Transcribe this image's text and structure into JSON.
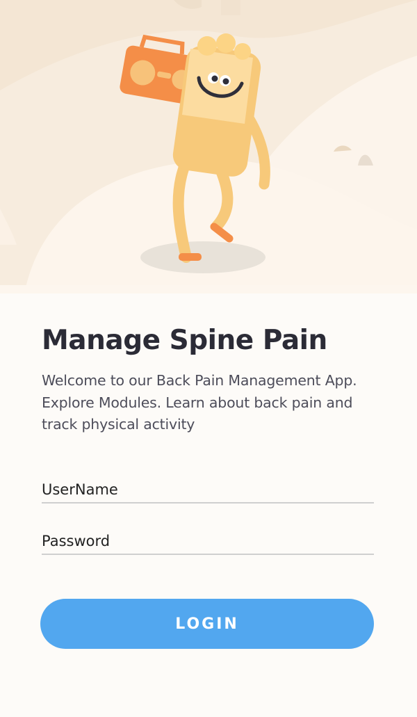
{
  "hero": {
    "illustration": "dancing-spine-with-boombox",
    "colors": {
      "background": "#f4e6d4",
      "hill_light": "#fbf3ea",
      "character": "#f7c97a",
      "character_head": "#fcdca0",
      "boombox": "#f48e48",
      "shadow": "#e8e2d9"
    }
  },
  "main": {
    "title": "Manage Spine Pain",
    "subtitle": "Welcome to our Back Pain Management App. Explore Modules. Learn about back pain and track physical activity"
  },
  "form": {
    "username_placeholder": "UserName",
    "password_placeholder": "Password",
    "login_label": "LOGIN"
  },
  "colors": {
    "accent": "#52a7ef",
    "title_text": "#2b2b36",
    "body_text": "#4d4d5a",
    "page_background": "#fdfbf8"
  }
}
